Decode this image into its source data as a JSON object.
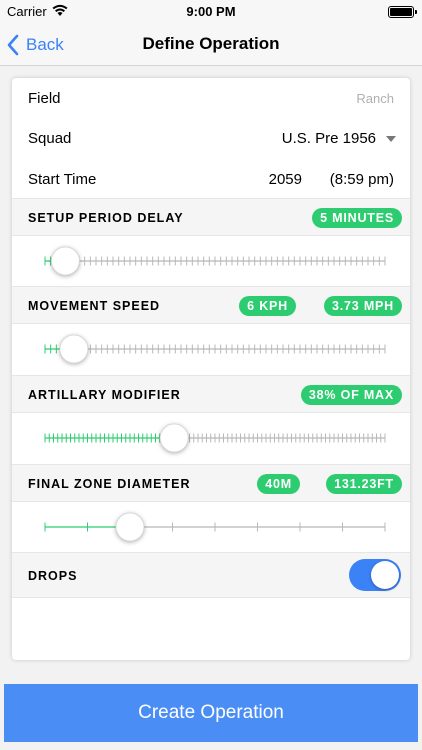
{
  "status_bar": {
    "carrier": "Carrier",
    "time": "9:00 PM"
  },
  "nav": {
    "back_label": "Back",
    "title": "Define Operation"
  },
  "form": {
    "field": {
      "label": "Field",
      "value": "Ranch"
    },
    "squad": {
      "label": "Squad",
      "value": "U.S. Pre 1956"
    },
    "start_time": {
      "label": "Start Time",
      "value": "2059",
      "display": "(8:59 pm)"
    }
  },
  "sections": {
    "setup_delay": {
      "title": "SETUP PERIOD DELAY",
      "badge": "5 MINUTES",
      "level": 0.06
    },
    "movement_speed": {
      "title": "MOVEMENT SPEED",
      "badge_kph": "6 KPH",
      "badge_mph": "3.73 MPH",
      "level": 0.085
    },
    "artillary_modifier": {
      "title": "ARTILLARY MODIFIER",
      "badge": "38% OF MAX",
      "level": 0.38
    },
    "final_zone": {
      "title": "FINAL ZONE DIAMETER",
      "badge_m": "40M",
      "badge_ft": "131.23FT",
      "level": 0.25
    },
    "drops": {
      "title": "DROPS",
      "enabled": true
    }
  },
  "create_button": "Create Operation",
  "colors": {
    "accent": "#3b82f6",
    "badge_green": "#2ecc71",
    "slider_active": "#2ecc71",
    "slider_inactive": "#b8b8b8"
  }
}
